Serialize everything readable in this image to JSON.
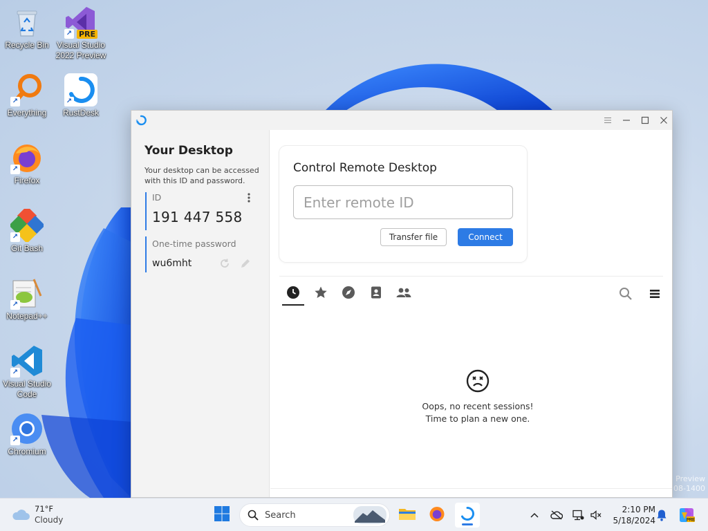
{
  "desktop": {
    "icons": [
      {
        "label": "Recycle Bin"
      },
      {
        "label": "Visual Studio 2022 Preview",
        "badge": "PRE"
      },
      {
        "label": "Everything"
      },
      {
        "label": "RustDesk"
      },
      {
        "label": "Firefox"
      },
      {
        "label": "Git Bash"
      },
      {
        "label": "Notepad++"
      },
      {
        "label": "Visual Studio Code"
      },
      {
        "label": "Chromium"
      }
    ],
    "watermark_line1": "Preview",
    "watermark_line2": "308-1400"
  },
  "window": {
    "app_icon": "rustdesk-icon",
    "controls": [
      "menu-icon",
      "minimize-icon",
      "maximize-icon",
      "close-icon"
    ],
    "sidebar": {
      "title": "Your Desktop",
      "description": "Your desktop can be accessed with this ID and password.",
      "id_label": "ID",
      "id_value": "191 447 558",
      "password_label": "One-time password",
      "password_value": "wu6mht"
    },
    "connect_card": {
      "title": "Control Remote Desktop",
      "input_placeholder": "Enter remote ID",
      "input_value": "",
      "transfer_label": "Transfer file",
      "connect_label": "Connect"
    },
    "tabs": [
      {
        "icon": "clock-icon",
        "name": "recent",
        "active": true
      },
      {
        "icon": "star-icon",
        "name": "favorites",
        "active": false
      },
      {
        "icon": "compass-icon",
        "name": "discovered",
        "active": false
      },
      {
        "icon": "address-book-icon",
        "name": "address-book",
        "active": false
      },
      {
        "icon": "group-icon",
        "name": "group",
        "active": false
      }
    ],
    "empty_state": {
      "icon": "sad-face-icon",
      "line1": "Oops, no recent sessions!",
      "line2": "Time to plan a new one."
    }
  },
  "taskbar": {
    "weather_temp": "71°F",
    "weather_desc": "Cloudy",
    "search_placeholder": "Search",
    "time": "2:10 PM",
    "date": "5/18/2024"
  },
  "colors": {
    "accent": "#2d7be5"
  }
}
